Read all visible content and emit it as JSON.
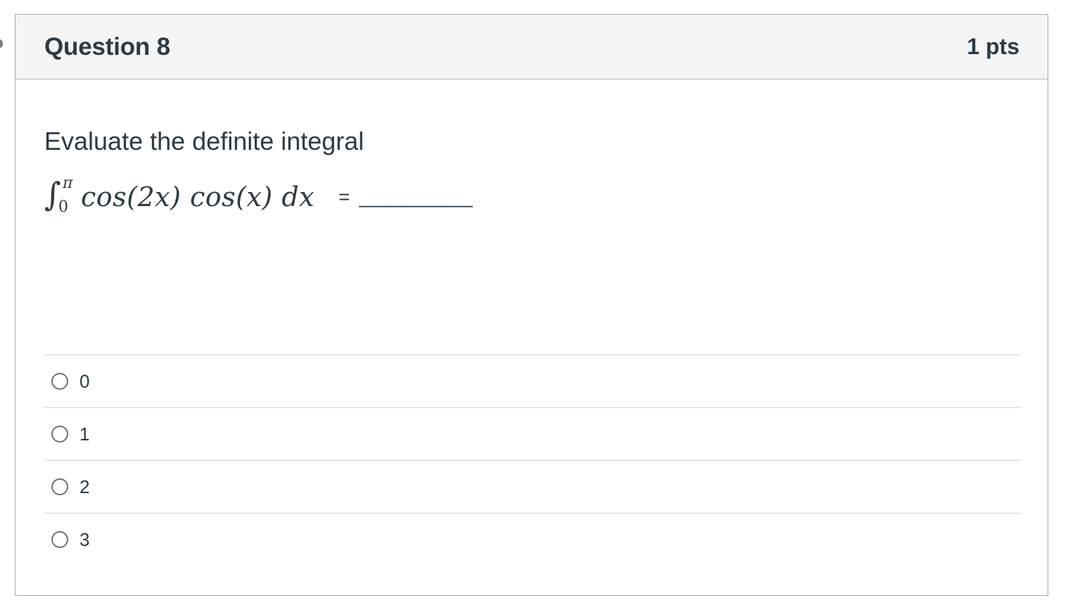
{
  "question": {
    "title": "Question 8",
    "points": "1 pts",
    "prompt": "Evaluate the definite integral",
    "equation": {
      "integral_sign": "∫",
      "upper_limit": "π",
      "lower_limit": "0",
      "integrand": "cos(2x) cos(x) dx",
      "equals": "=",
      "blank": "___________"
    },
    "answers": [
      {
        "label": "0",
        "selected": false
      },
      {
        "label": "1",
        "selected": false
      },
      {
        "label": "2",
        "selected": false
      },
      {
        "label": "3",
        "selected": false
      }
    ]
  }
}
